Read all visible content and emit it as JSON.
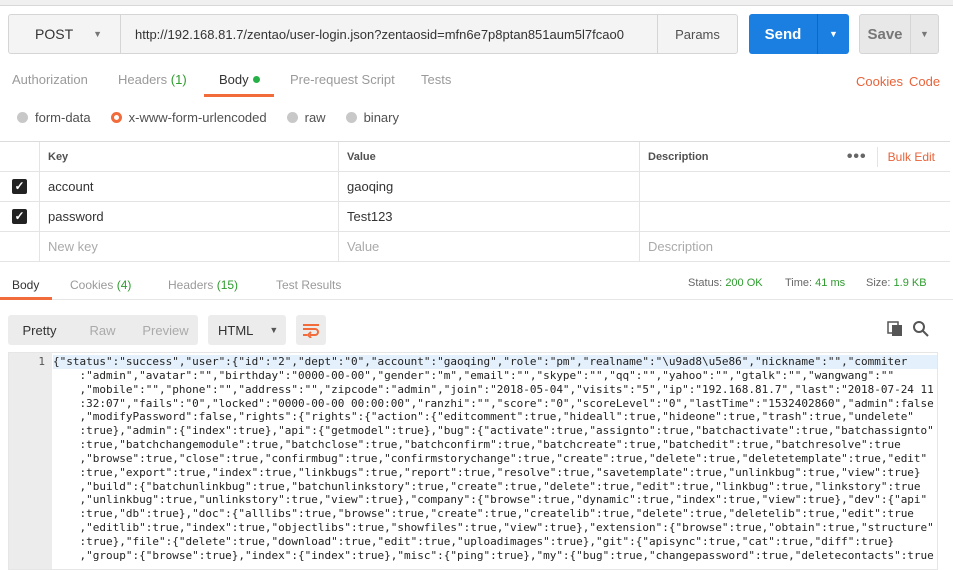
{
  "request": {
    "method": "POST",
    "url": "http://192.168.81.7/zentao/user-login.json?zentaosid=mfn6e7p8ptan851aum5l7fcao0",
    "params_label": "Params",
    "send_label": "Send",
    "save_label": "Save"
  },
  "request_tabs": [
    {
      "label": "Authorization"
    },
    {
      "label": "Headers",
      "count": "(1)"
    },
    {
      "label": "Body"
    },
    {
      "label": "Pre-request Script"
    },
    {
      "label": "Tests"
    }
  ],
  "links": {
    "cookies": "Cookies",
    "code": "Code"
  },
  "body_types": [
    "form-data",
    "x-www-form-urlencoded",
    "raw",
    "binary"
  ],
  "body_type_selected": "x-www-form-urlencoded",
  "kv_table": {
    "headers": {
      "key": "Key",
      "value": "Value",
      "description": "Description"
    },
    "bulk_edit": "Bulk Edit",
    "rows": [
      {
        "key": "account",
        "value": "gaoqing",
        "checked": true
      },
      {
        "key": "password",
        "value": "Test123",
        "checked": true
      }
    ],
    "placeholders": {
      "key": "New key",
      "value": "Value",
      "description": "Description"
    }
  },
  "response_tabs": [
    {
      "label": "Body"
    },
    {
      "label": "Cookies",
      "count": "(4)"
    },
    {
      "label": "Headers",
      "count": "(15)"
    },
    {
      "label": "Test Results"
    }
  ],
  "status": {
    "status_label": "Status:",
    "status_value": "200 OK",
    "time_label": "Time:",
    "time_value": "41 ms",
    "size_label": "Size:",
    "size_value": "1.9 KB"
  },
  "view_modes": [
    "Pretty",
    "Raw",
    "Preview"
  ],
  "language": "HTML",
  "code": {
    "line_number": "1",
    "lines": [
      "{\"status\":\"success\",\"user\":{\"id\":\"2\",\"dept\":\"0\",\"account\":\"gaoqing\",\"role\":\"pm\",\"realname\":\"\\u9ad8\\u5e86\",\"nickname\":\"\",\"commiter",
      "    :\"admin\",\"avatar\":\"\",\"birthday\":\"0000-00-00\",\"gender\":\"m\",\"email\":\"\",\"skype\":\"\",\"qq\":\"\",\"yahoo\":\"\",\"gtalk\":\"\",\"wangwang\":\"\"",
      "    ,\"mobile\":\"\",\"phone\":\"\",\"address\":\"\",\"zipcode\":\"admin\",\"join\":\"2018-05-04\",\"visits\":\"5\",\"ip\":\"192.168.81.7\",\"last\":\"2018-07-24 11",
      "    :32:07\",\"fails\":\"0\",\"locked\":\"0000-00-00 00:00:00\",\"ranzhi\":\"\",\"score\":\"0\",\"scoreLevel\":\"0\",\"lastTime\":\"1532402860\",\"admin\":false",
      "    ,\"modifyPassword\":false,\"rights\":{\"rights\":{\"action\":{\"editcomment\":true,\"hideall\":true,\"hideone\":true,\"trash\":true,\"undelete\"",
      "    :true},\"admin\":{\"index\":true},\"api\":{\"getmodel\":true},\"bug\":{\"activate\":true,\"assignto\":true,\"batchactivate\":true,\"batchassignto\"",
      "    :true,\"batchchangemodule\":true,\"batchclose\":true,\"batchconfirm\":true,\"batchcreate\":true,\"batchedit\":true,\"batchresolve\":true",
      "    ,\"browse\":true,\"close\":true,\"confirmbug\":true,\"confirmstorychange\":true,\"create\":true,\"delete\":true,\"deletetemplate\":true,\"edit\"",
      "    :true,\"export\":true,\"index\":true,\"linkbugs\":true,\"report\":true,\"resolve\":true,\"savetemplate\":true,\"unlinkbug\":true,\"view\":true}",
      "    ,\"build\":{\"batchunlinkbug\":true,\"batchunlinkstory\":true,\"create\":true,\"delete\":true,\"edit\":true,\"linkbug\":true,\"linkstory\":true",
      "    ,\"unlinkbug\":true,\"unlinkstory\":true,\"view\":true},\"company\":{\"browse\":true,\"dynamic\":true,\"index\":true,\"view\":true},\"dev\":{\"api\"",
      "    :true,\"db\":true},\"doc\":{\"alllibs\":true,\"browse\":true,\"create\":true,\"createlib\":true,\"delete\":true,\"deletelib\":true,\"edit\":true",
      "    ,\"editlib\":true,\"index\":true,\"objectlibs\":true,\"showfiles\":true,\"view\":true},\"extension\":{\"browse\":true,\"obtain\":true,\"structure\"",
      "    :true},\"file\":{\"delete\":true,\"download\":true,\"edit\":true,\"uploadimages\":true},\"git\":{\"apisync\":true,\"cat\":true,\"diff\":true}",
      "    ,\"group\":{\"browse\":true},\"index\":{\"index\":true},\"misc\":{\"ping\":true},\"my\":{\"bug\":true,\"changepassword\":true,\"deletecontacts\":true"
    ]
  }
}
